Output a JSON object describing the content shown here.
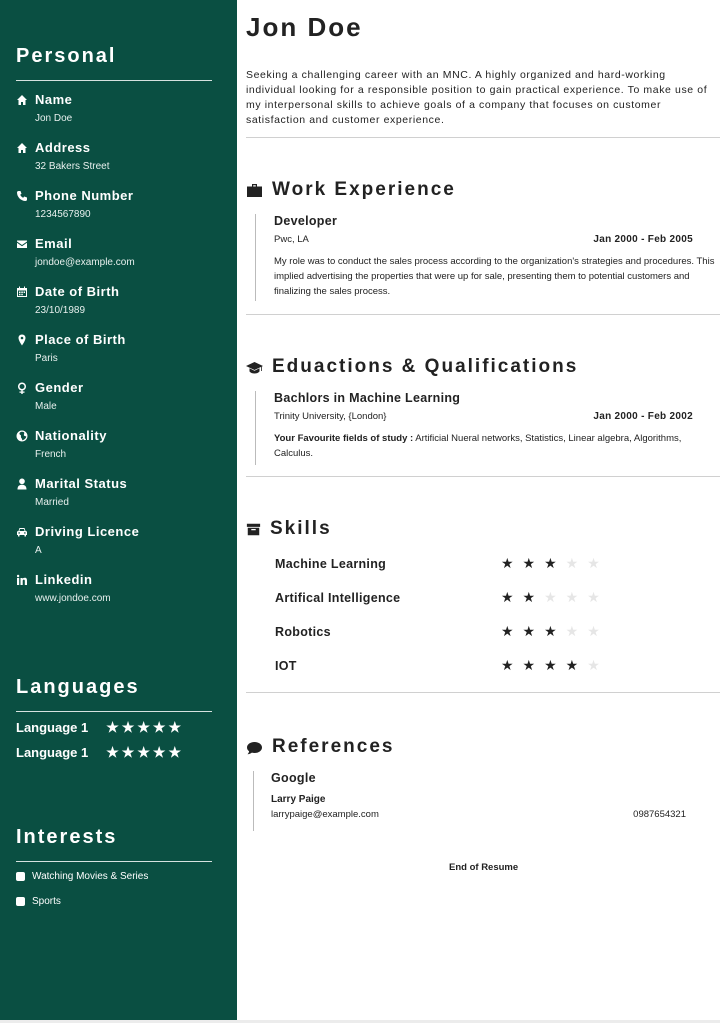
{
  "sidebar": {
    "personal_title": "Personal",
    "personal_items": [
      {
        "label": "Name",
        "value": "Jon Doe",
        "icon": "home-icon"
      },
      {
        "label": "Address",
        "value": "32 Bakers Street",
        "icon": "home-icon"
      },
      {
        "label": "Phone Number",
        "value": "1234567890",
        "icon": "phone-icon"
      },
      {
        "label": "Email",
        "value": "jondoe@example.com",
        "icon": "envelope-icon"
      },
      {
        "label": "Date of Birth",
        "value": "23/10/1989",
        "icon": "calendar-icon"
      },
      {
        "label": "Place of Birth",
        "value": "Paris",
        "icon": "map-marker-icon"
      },
      {
        "label": "Gender",
        "value": "Male",
        "icon": "genderless-icon"
      },
      {
        "label": "Nationality",
        "value": "French",
        "icon": "globe-icon"
      },
      {
        "label": "Marital Status",
        "value": "Married",
        "icon": "user-icon"
      },
      {
        "label": "Driving Licence",
        "value": "A",
        "icon": "car-icon"
      },
      {
        "label": "Linkedin",
        "value": "www.jondoe.com",
        "icon": "linkedin-icon"
      }
    ],
    "languages_title": "Languages",
    "languages": [
      {
        "name": "Language 1",
        "rating": 5,
        "max": 5
      },
      {
        "name": "Language 1",
        "rating": 5,
        "max": 5
      }
    ],
    "interests_title": "Interests",
    "interests": [
      "Watching Movies & Series",
      "Sports"
    ]
  },
  "main": {
    "name": "Jon Doe",
    "summary": "Seeking a challenging career with an MNC. A highly organized and hard-working individual looking for a responsible position to gain practical experience. To make use of my interpersonal skills to achieve goals of a company that focuses on customer satisfaction and customer experience.",
    "work": {
      "title": "Work Experience",
      "role": "Developer",
      "company": "Pwc, LA",
      "dates": "Jan 2000 - Feb 2005",
      "description": "My role was to conduct the sales process according to the organization's strategies and procedures. This implied advertising the properties that were up for sale, presenting them to potential customers and finalizing the sales process."
    },
    "education": {
      "title": "Eduactions & Qualifications",
      "degree": "Bachlors in Machine Learning",
      "institution": "Trinity University, {London}",
      "dates": "Jan 2000 - Feb 2002",
      "fields_label": "Your Favourite fields of study :",
      "fields": " Artificial Nueral networks, Statistics, Linear algebra, Algorithms, Calculus."
    },
    "skills": {
      "title": "Skills",
      "items": [
        {
          "name": "Machine Learning",
          "rating": 3,
          "max": 5
        },
        {
          "name": "Artifical Intelligence",
          "rating": 2,
          "max": 5
        },
        {
          "name": "Robotics",
          "rating": 3,
          "max": 5
        },
        {
          "name": "IOT",
          "rating": 4,
          "max": 5
        }
      ]
    },
    "references": {
      "title": "References",
      "organization": "Google",
      "person": "Larry Paige",
      "email": "larrypaige@example.com",
      "phone": "0987654321"
    },
    "end_text": "End of Resume"
  },
  "colors": {
    "sidebar": "#0a4f42",
    "text": "#222222",
    "star_off": "#e6e6e6"
  }
}
